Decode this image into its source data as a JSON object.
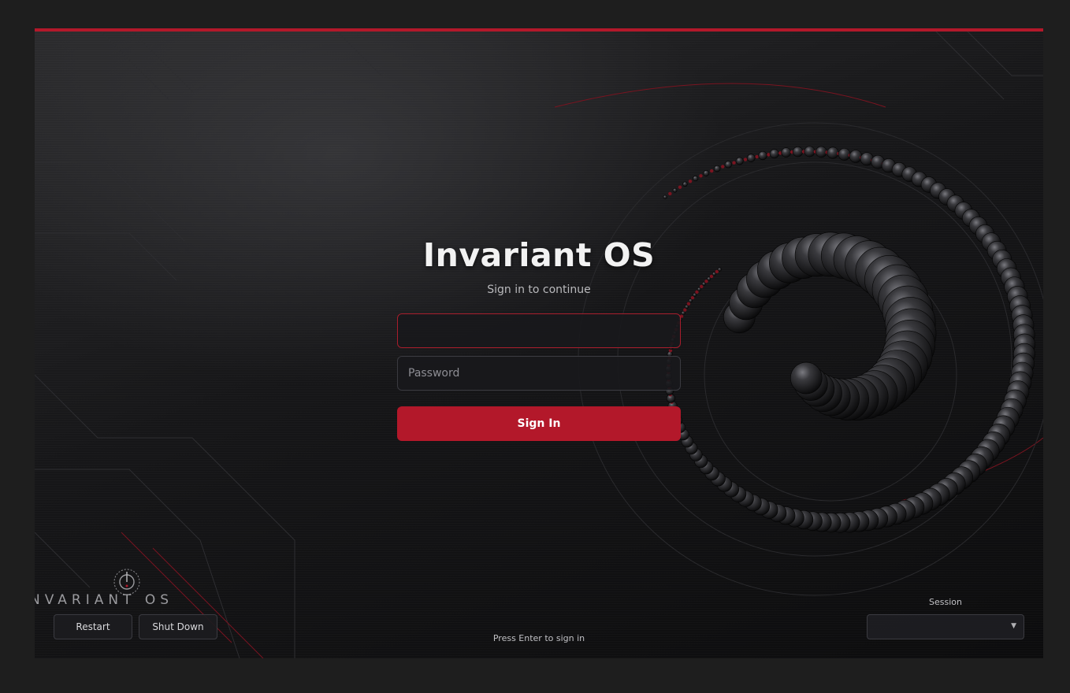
{
  "login": {
    "title": "Invariant OS",
    "subtitle": "Sign in to continue",
    "username_value": "",
    "username_placeholder": "",
    "password_placeholder": "Password",
    "signin_label": "Sign In"
  },
  "logo": {
    "text": "NVARIANT OS"
  },
  "power": {
    "restart_label": "Restart",
    "shutdown_label": "Shut Down"
  },
  "hint": "Press Enter to sign in",
  "session": {
    "label": "Session",
    "value": ""
  },
  "colors": {
    "accent": "#b3182a",
    "background": "#1e1e1e",
    "field_bg": "#18181c"
  },
  "icons": {
    "logo": "power-ring-icon",
    "dropdown": "chevron-down-icon"
  }
}
